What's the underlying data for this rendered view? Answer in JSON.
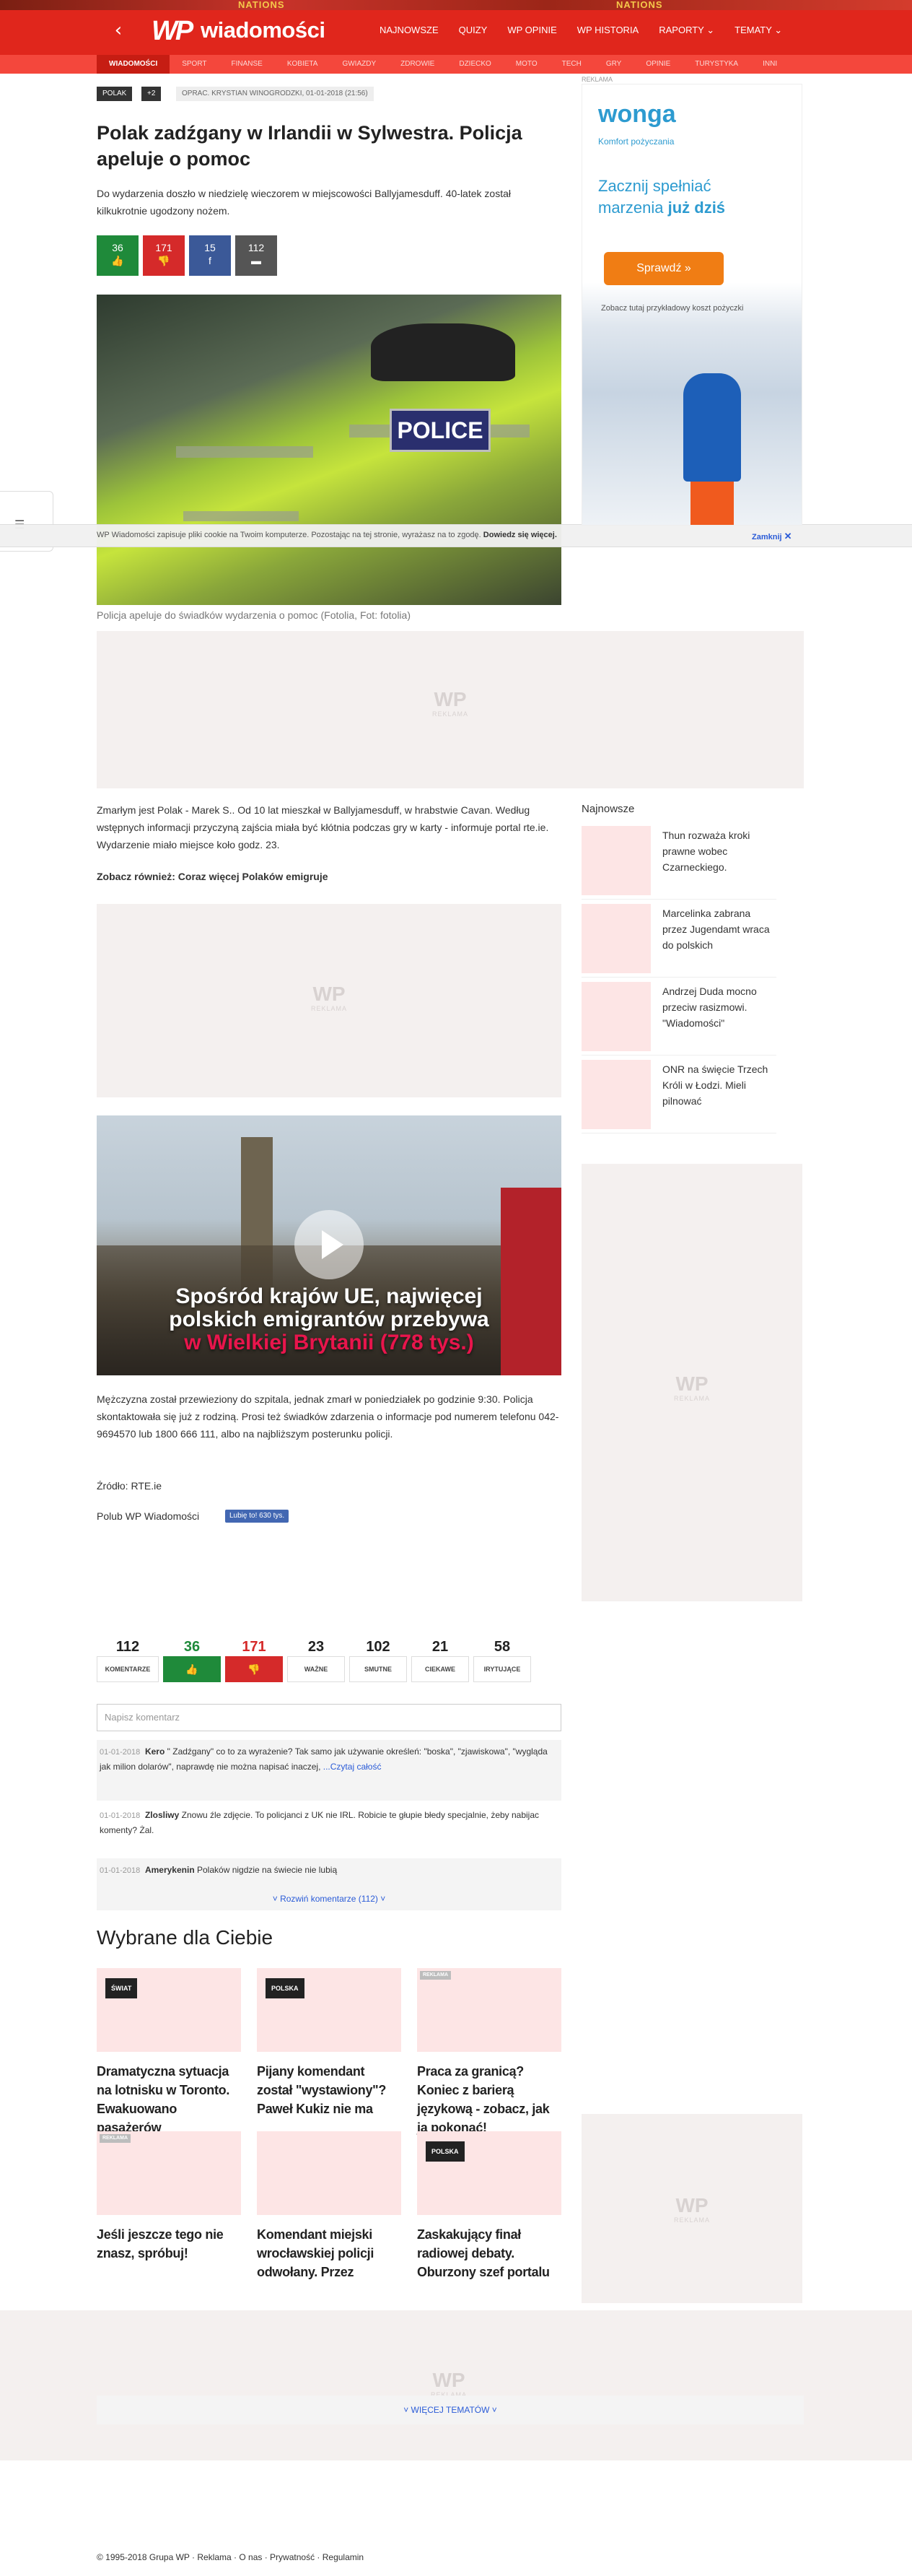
{
  "promo": {
    "text_left": "NATIONS",
    "text_right": "NATIONS"
  },
  "header": {
    "logo_mark": "WP",
    "logo_text": "wiadomości",
    "nav": [
      "NAJNOWSZE",
      "QUIZY",
      "WP OPINIE",
      "WP HISTORIA",
      "RAPORTY",
      "TEMATY"
    ]
  },
  "subnav": [
    "WIADOMOŚCI",
    "SPORT",
    "FINANSE",
    "KOBIETA",
    "GWIAZDY",
    "ZDROWIE",
    "DZIECKO",
    "MOTO",
    "TECH",
    "GRY",
    "OPINIE",
    "TURYSTYKA",
    "INNI"
  ],
  "article": {
    "tags": [
      "POLAK",
      "+2"
    ],
    "byline": "OPRAC. KRYSTIAN WINOGRODZKI, 01-01-2018 (21:56)",
    "title": "Polak zadźgany w Irlandii w Sylwestra. Policja apeluje o pomoc",
    "lead": "Do wydarzenia doszło w niedzielę wieczorem w miejscowości Ballyjamesduff. 40-latek został kilkukrotnie ugodzony nożem.",
    "votes": {
      "up": "36",
      "down": "171",
      "fb": "15",
      "comments": "112"
    },
    "photo_text": "POLICE",
    "caption": "Policja apeluje do świadków wydarzenia o pomoc (Fotolia, Fot: fotolia)",
    "p1": "Zmarłym jest Polak - Marek S.. Od 10 lat mieszkał w Ballyjamesduff, w hrabstwie Cavan. Według wstępnych informacji przyczyną zajścia miała być kłótnia podczas gry w karty - informuje portal rte.ie. Wydarzenie miało miejsce koło godz. 23.",
    "see_also": "Zobacz również: Coraz więcej Polaków emigruje",
    "video_title_1": "Spośród krajów UE, najwięcej",
    "video_title_2": "polskich emigrantów przebywa",
    "video_title_3": "w Wielkiej Brytanii (778 tys.)",
    "p2": "Mężczyzna został przewieziony do szpitala, jednak zmarł w poniedziałek po godzinie 9:30. Policja skontaktowała się już z rodziną. Prosi też świadków zdarzenia o informacje pod numerem telefonu 042-9694570 lub 1800 666 111, albo na najbliższym posterunku policji.",
    "source": "Źródło: RTE.ie",
    "like_label": "Polub WP Wiadomości",
    "like_button": "Lubię to! 630 tys."
  },
  "ad_label": "REKLAMA",
  "cookie": {
    "text": "WP Wiadomości zapisuje pliki cookie na Twoim komputerze. Pozostając na tej stronie, wyrażasz na to zgodę.",
    "link": "Dowiedz się więcej.",
    "close": "Zamknij"
  },
  "sidebar_ad": {
    "label": "REKLAMA",
    "brand": "wonga",
    "tagline": "Komfort pożyczania",
    "headline_1": "Zacznij spełniać",
    "headline_2": "marzenia ",
    "headline_bold": "już dziś",
    "button": "Sprawdź »",
    "note": "Zobacz tutaj przykładowy koszt pożyczki"
  },
  "latest": {
    "heading": "Najnowsze",
    "items": [
      "Thun rozważa kroki prawne wobec Czarneckiego.",
      "Marcelinka zabrana przez Jugendamt wraca do polskich",
      "Andrzej Duda mocno przeciw rasizmowi. \"Wiadomości\"",
      "ONR na święcie Trzech Króli w Łodzi. Mieli pilnować"
    ]
  },
  "reactions": [
    {
      "count": "112",
      "label": "KOMENTARZE"
    },
    {
      "count": "36",
      "label": "👍"
    },
    {
      "count": "171",
      "label": "👎"
    },
    {
      "count": "23",
      "label": "WAŻNE"
    },
    {
      "count": "102",
      "label": "SMUTNE"
    },
    {
      "count": "21",
      "label": "CIEKAWE"
    },
    {
      "count": "58",
      "label": "IRYTUJĄCE"
    }
  ],
  "comments": {
    "placeholder": "Napisz komentarz",
    "items": [
      {
        "date": "01-01-2018",
        "user": "Kero",
        "text": "\" Zadźgany\" co to za wyrażenie? Tak samo jak używanie określeń: \"boska\", \"zjawiskowa\", \"wygląda jak milion dolarów\", naprawdę nie można napisać inaczej,",
        "more": "...Czytaj całość"
      },
      {
        "date": "01-01-2018",
        "user": "Zlosliwy",
        "text": "Znowu źle zdjęcie. To policjanci z UK nie IRL. Robicie te głupie błedy specjalnie, żeby nabijac komenty? Żal.",
        "more": ""
      },
      {
        "date": "01-01-2018",
        "user": "Amerykenin",
        "text": "Polaków nigdzie na świecie nie lubią",
        "more": ""
      }
    ],
    "expand": "˅ Rozwiń komentarze (112) ˅"
  },
  "picked": {
    "heading": "Wybrane dla Ciebie",
    "cards": [
      {
        "tag": "ŚWIAT",
        "title": "Dramatyczna sytuacja na lotnisku w Toronto. Ewakuowano pasażerów"
      },
      {
        "tag": "POLSKA",
        "title": "Pijany komendant został \"wystawiony\"? Paweł Kukiz nie ma"
      },
      {
        "tag": "REKLAMA",
        "title": "Praca za granicą? Koniec z barierą językową - zobacz, jak ją pokonać!"
      },
      {
        "tag": "REKLAMA",
        "title": "Jeśli jeszcze tego nie znasz, spróbuj!"
      },
      {
        "tag": "",
        "title": "Komendant miejski wrocławskiej policji odwołany. Przez"
      },
      {
        "tag": "POLSKA",
        "title": "Zaskakujący finał radiowej debaty. Oburzony szef portalu"
      }
    ]
  },
  "footer": {
    "more_topics": "˅ WIĘCEJ TEMATÓW ˅",
    "links": "© 1995-2018 Grupa WP  ·  Reklama  ·  O nas  ·  Prywatność  ·  Regulamin"
  }
}
